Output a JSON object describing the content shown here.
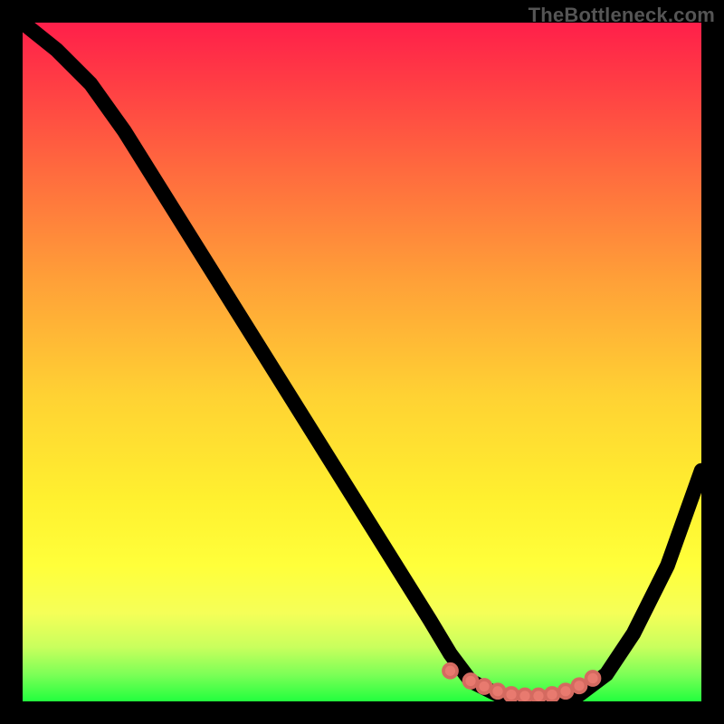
{
  "watermark": "TheBottleneck.com",
  "chart_data": {
    "type": "line",
    "title": "",
    "xlabel": "",
    "ylabel": "",
    "xlim": [
      0,
      100
    ],
    "ylim": [
      0,
      100
    ],
    "grid": false,
    "legend": false,
    "series": [
      {
        "name": "bottleneck-curve",
        "x": [
          0,
          5,
          10,
          15,
          20,
          25,
          30,
          35,
          40,
          45,
          50,
          55,
          60,
          63,
          66,
          70,
          74,
          78,
          82,
          86,
          90,
          95,
          100
        ],
        "y": [
          100,
          96,
          91,
          84,
          76,
          68,
          60,
          52,
          44,
          36,
          28,
          20,
          12,
          7,
          3,
          1,
          0,
          0,
          1,
          4,
          10,
          20,
          34
        ]
      }
    ],
    "markers": {
      "name": "highlight-dots",
      "color": "#e87a6f",
      "x": [
        63,
        66,
        68,
        70,
        72,
        74,
        76,
        78,
        80,
        82,
        84
      ],
      "y": [
        4.5,
        3.0,
        2.2,
        1.5,
        1.0,
        0.8,
        0.8,
        1.0,
        1.5,
        2.3,
        3.4
      ]
    },
    "background_gradient": {
      "top": "#ff1f4a",
      "middle": "#ffff3a",
      "bottom": "#22ff3e"
    }
  }
}
